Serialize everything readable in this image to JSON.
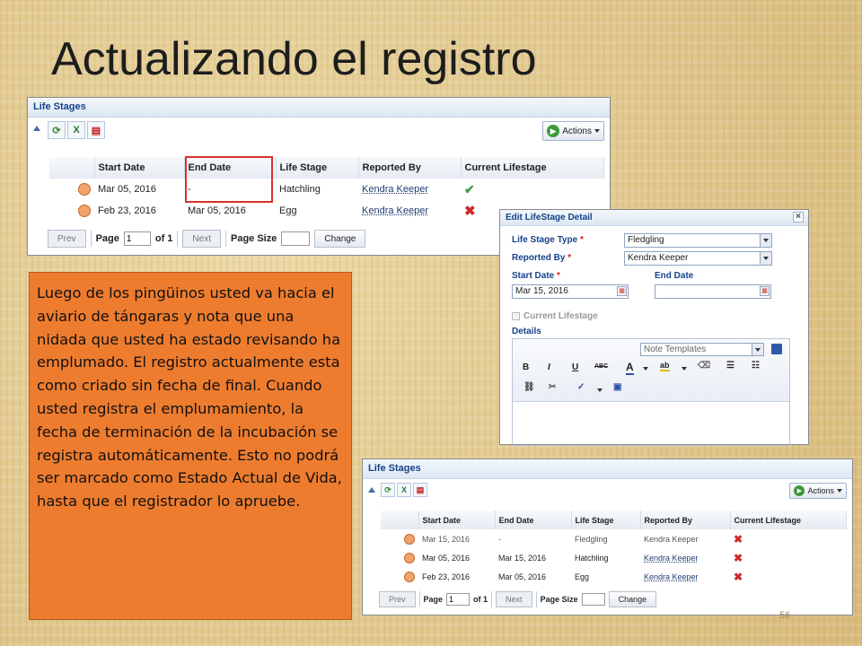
{
  "slide": {
    "title": "Actualizando el registro",
    "body": "Luego de los pingüinos usted va hacia el aviario de tángaras y nota que una nidada que usted ha estado revisando ha emplumado. El registro actualmente esta como criado sin fecha de final. Cuando usted registra el emplumamiento, la fecha de terminación de la incubación se registra automáticamente. Esto no podrá ser marcado como Estado Actual de Vida, hasta que el registrador lo apruebe.",
    "page_number": "56"
  },
  "panel_top": {
    "title": "Life Stages",
    "actions_label": "Actions",
    "columns": [
      "Start Date",
      "End Date",
      "Life Stage",
      "Reported By",
      "Current Lifestage"
    ],
    "rows": [
      {
        "start": "Mar 05, 2016",
        "end": "-",
        "stage": "Hatchling",
        "reported_by": "Kendra Keeper",
        "current": "check-icon"
      },
      {
        "start": "Feb 23, 2016",
        "end": "Mar 05, 2016",
        "stage": "Egg",
        "reported_by": "Kendra Keeper",
        "current": "cross-icon"
      }
    ],
    "pager": {
      "prev": "Prev",
      "page_label": "Page",
      "page_value": "1",
      "of_label": "of 1",
      "next": "Next",
      "page_size_label": "Page Size",
      "page_size_value": "",
      "change": "Change"
    }
  },
  "edit_dialog": {
    "title": "Edit LifeStage Detail",
    "life_stage_type_label": "Life Stage Type",
    "life_stage_type_value": "Fledgling",
    "reported_by_label": "Reported By",
    "reported_by_value": "Kendra Keeper",
    "start_date_label": "Start Date",
    "start_date_value": "Mar 15, 2016",
    "end_date_label": "End Date",
    "end_date_value": "",
    "current_lifestage_label": "Current Lifestage",
    "details_label": "Details",
    "note_templates_placeholder": "Note Templates",
    "required_marker": "*",
    "editor_buttons": {
      "bold": "B",
      "italic": "I",
      "underline": "U",
      "strike": "ABC",
      "font_color": "A",
      "highlight": "ab"
    }
  },
  "panel_bottom": {
    "title": "Life Stages",
    "actions_label": "Actions",
    "columns": [
      "Start Date",
      "End Date",
      "Life Stage",
      "Reported By",
      "Current Lifestage"
    ],
    "rows": [
      {
        "start": "Mar 15, 2016",
        "end": "-",
        "stage": "Fledgling",
        "reported_by": "Kendra Keeper",
        "current": "cross-icon"
      },
      {
        "start": "Mar 05, 2016",
        "end": "Mar 15, 2016",
        "stage": "Hatchling",
        "reported_by": "Kendra Keeper",
        "current": "cross-icon"
      },
      {
        "start": "Feb 23, 2016",
        "end": "Mar 05, 2016",
        "stage": "Egg",
        "reported_by": "Kendra Keeper",
        "current": "cross-icon"
      }
    ],
    "pager": {
      "prev": "Prev",
      "page_label": "Page",
      "page_value": "1",
      "of_label": "of 1",
      "next": "Next",
      "page_size_label": "Page Size",
      "page_size_value": "",
      "change": "Change"
    }
  },
  "colors": {
    "text_box_bg": "#ee7c2f",
    "highlight": "#d6322e",
    "header_text": "#15428b"
  }
}
